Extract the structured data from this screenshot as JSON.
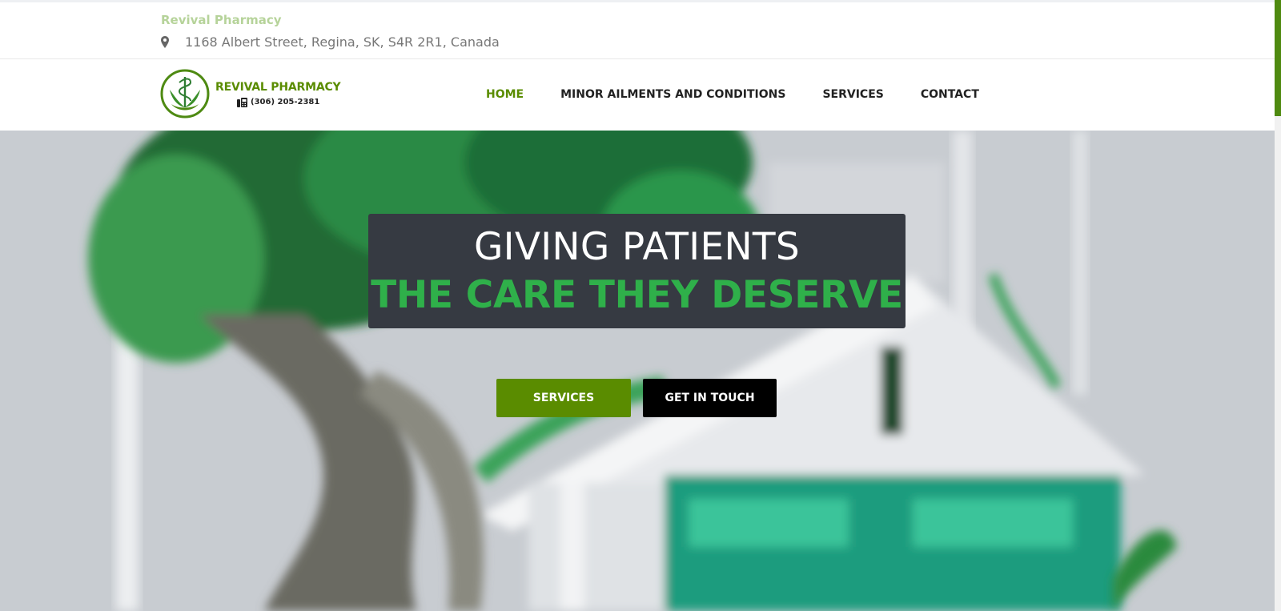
{
  "colors": {
    "brand_green": "#5a8c00",
    "light_green": "#b6d39a",
    "headline_green": "#2fb04a",
    "headline_box": "#363a42",
    "scroll_thumb": "#4f8a10"
  },
  "topbar": {
    "site_name": "Revival Pharmacy",
    "address_icon": "map-pin-icon",
    "address": "1168 Albert Street, Regina, SK, S4R 2R1, Canada"
  },
  "logo": {
    "name": "REVIVAL PHARMACY",
    "phone_icon": "phone-icon",
    "phone": "(306) 205-2381"
  },
  "nav": {
    "active": "HOME",
    "items": [
      "HOME",
      "MINOR AILMENTS AND CONDITIONS",
      "SERVICES",
      "CONTACT"
    ]
  },
  "hero": {
    "headline_line1": "GIVING PATIENTS",
    "headline_line2": "THE CARE THEY DESERVE",
    "button_primary": "SERVICES",
    "button_secondary": "GET IN TOUCH"
  }
}
